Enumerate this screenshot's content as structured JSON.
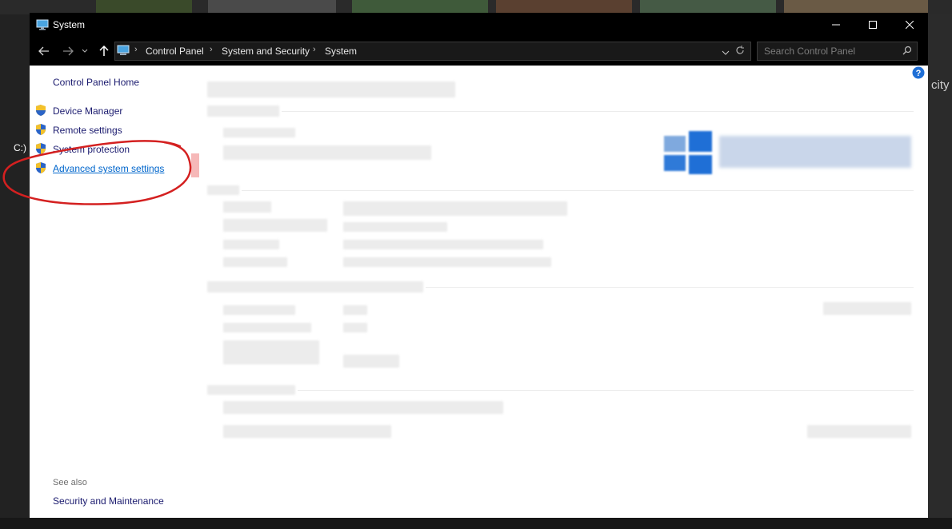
{
  "background": {
    "left_label": "C:)",
    "right_label": "city"
  },
  "window": {
    "title": "System",
    "controls": {
      "minimize": "—",
      "maximize": "☐",
      "close": "✕"
    }
  },
  "nav": {
    "breadcrumbs": [
      "Control Panel",
      "System and Security",
      "System"
    ],
    "search_placeholder": "Search Control Panel"
  },
  "left_pane": {
    "home": "Control Panel Home",
    "links": [
      "Device Manager",
      "Remote settings",
      "System protection",
      "Advanced system settings"
    ],
    "see_also": "See also",
    "security": "Security and Maintenance"
  },
  "colors": {
    "title_bg": "#000000",
    "link_blue": "#0066cc",
    "annotation_red": "#d42020",
    "windows_blue": "#1f6fd6"
  },
  "icons": {
    "help": "help-icon",
    "shield": "uac-shield-icon"
  }
}
